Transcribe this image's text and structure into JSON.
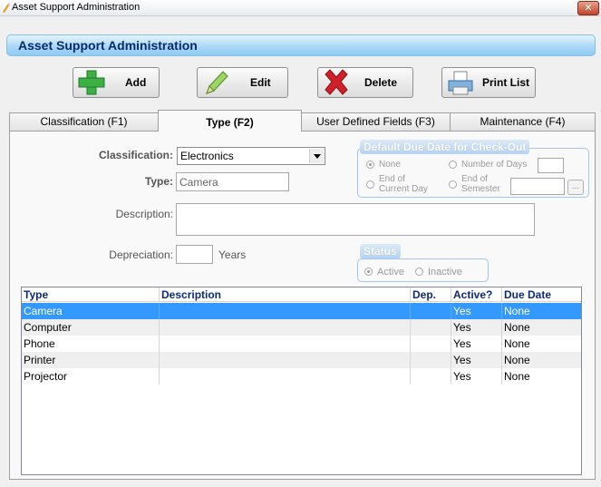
{
  "window": {
    "title": "Asset Support Administration",
    "close_label": "✕"
  },
  "header": {
    "title": "Asset Support Administration"
  },
  "toolbar": {
    "add_label": "Add",
    "edit_label": "Edit",
    "delete_label": "Delete",
    "print_label": "Print List"
  },
  "tabs": [
    {
      "label": "Classification (F1)"
    },
    {
      "label": "Type (F2)"
    },
    {
      "label": "User Defined Fields (F3)"
    },
    {
      "label": "Maintenance (F4)"
    }
  ],
  "form": {
    "classification_label": "Classification:",
    "classification_value": "Electronics",
    "type_label": "Type:",
    "type_value": "Camera",
    "description_label": "Description:",
    "description_value": "",
    "depreciation_label": "Depreciation:",
    "depreciation_value": "",
    "years_label": "Years"
  },
  "due_date_group": {
    "title": "Default Due Date for Check-Out",
    "none_label": "None",
    "number_of_days_label": "Number of Days",
    "end_of_current_day_label_1": "End of",
    "end_of_current_day_label_2": "Current Day",
    "end_of_semester_label_1": "End of",
    "end_of_semester_label_2": "Semester",
    "browse_label": "...",
    "selected": "None"
  },
  "status_group": {
    "title": "Status",
    "active_label": "Active",
    "inactive_label": "Inactive",
    "selected": "Active"
  },
  "grid": {
    "columns": [
      "Type",
      "Description",
      "Dep.",
      "Active?",
      "Due Date"
    ],
    "rows": [
      {
        "type": "Camera",
        "description": "",
        "dep": "",
        "active": "Yes",
        "due_date": "None"
      },
      {
        "type": "Computer",
        "description": "",
        "dep": "",
        "active": "Yes",
        "due_date": "None"
      },
      {
        "type": "Phone",
        "description": "",
        "dep": "",
        "active": "Yes",
        "due_date": "None"
      },
      {
        "type": "Printer",
        "description": "",
        "dep": "",
        "active": "Yes",
        "due_date": "None"
      },
      {
        "type": "Projector",
        "description": "",
        "dep": "",
        "active": "Yes",
        "due_date": "None"
      }
    ],
    "selected_row": 0
  },
  "colors": {
    "header_text": "#0a2a6b",
    "grid_header_text": "#0b2a79",
    "selection": "#3399ff",
    "add_icon": "#3cb043",
    "delete_icon": "#d0202a",
    "edit_icon": "#7cc243"
  }
}
